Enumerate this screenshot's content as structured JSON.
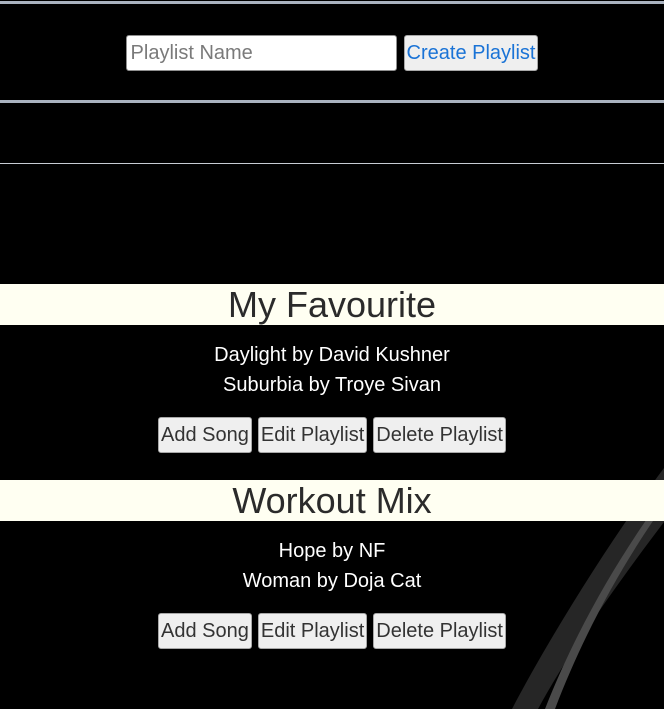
{
  "create": {
    "placeholder": "Playlist Name",
    "value": "",
    "button_label": "Create Playlist"
  },
  "playlists": [
    {
      "title": "My Favourite",
      "songs": [
        "Daylight by David Kushner",
        "Suburbia by Troye Sivan"
      ],
      "actions": {
        "add": "Add Song",
        "edit": "Edit Playlist",
        "delete": "Delete Playlist"
      }
    },
    {
      "title": "Workout Mix",
      "songs": [
        "Hope by NF",
        "Woman by Doja Cat"
      ],
      "actions": {
        "add": "Add Song",
        "edit": "Edit Playlist",
        "delete": "Delete Playlist"
      }
    }
  ],
  "colors": {
    "page_background": "#000000",
    "title_band": "#fffff2",
    "link_blue": "#1a73d6",
    "divider": "#aab3c0"
  }
}
